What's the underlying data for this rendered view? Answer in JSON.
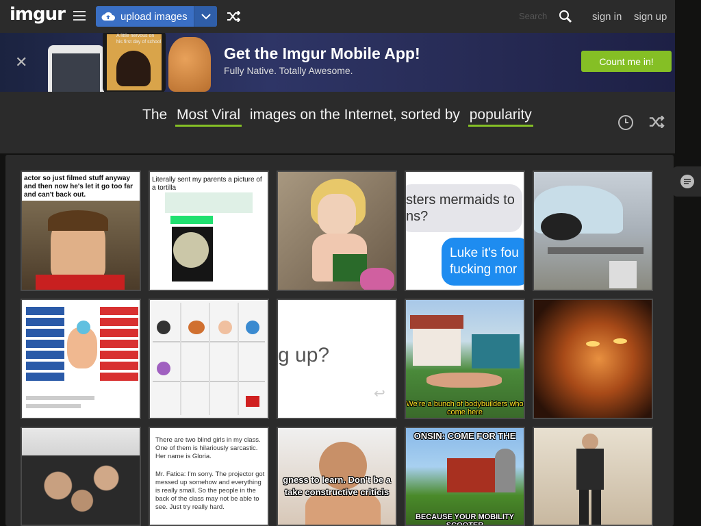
{
  "header": {
    "logo": "imgur",
    "upload_label": "upload images",
    "search_placeholder": "Search",
    "signin": "sign in",
    "signup": "sign up"
  },
  "banner": {
    "title": "Get the Imgur Mobile App!",
    "subtitle": "Fully Native. Totally Awesome.",
    "cta": "Count me in!",
    "phone_text": "A little nervous on his first day of school"
  },
  "headline": {
    "prefix": "The",
    "sort_type": "Most Viral",
    "middle": "images on the Internet, sorted by",
    "sort_by": "popularity"
  },
  "tiles": {
    "t1": "actor so just filmed stuff anyway and then now he's let it go too far and can't back out.",
    "t2": "Literally sent my parents a picture of a tortilla",
    "t4a": "sters mermaids to",
    "t4b": "ns?",
    "t4c": "Luke it's fou",
    "t4d": "fucking mor",
    "t8": "g up?",
    "t9": "We're a bunch of bodybuilders who come here",
    "t12": "There are two blind girls in my class. One of them is hilariously sarcastic. Her name is Gloria.",
    "t12b": "Mr. Fatica: I'm sorry. The projector got messed up somehow and everything is really small. So the people in the back of the class may not be able to see. Just try really hard.",
    "t13a": "gness to learn. Don't be a",
    "t13b": "take constructive criticis",
    "t14a": "ONSIN: COME FOR THE",
    "t14b": "BECAUSE YOUR MOBILITY SCOOTER"
  },
  "colors": {
    "accent_green": "#85bf25",
    "upload_blue": "#3a6fc4",
    "header_bg": "#2b2b2b"
  }
}
